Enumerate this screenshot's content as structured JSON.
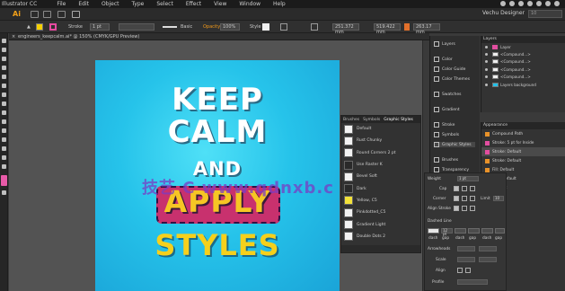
{
  "menubar": {
    "app": "Illustrator CC",
    "items": [
      "File",
      "Edit",
      "Object",
      "Type",
      "Select",
      "Effect",
      "View",
      "Window",
      "Help"
    ]
  },
  "toolbar": {
    "logo": "Ai",
    "workspace": "Vechu Designer",
    "search_value": "10"
  },
  "controlbar": {
    "stroke_label": "Stroke",
    "stroke_value": "1 pt",
    "brush_label": "Basic",
    "opacity_label": "Opacity",
    "opacity_value": "100%",
    "style_label": "Style",
    "x_value": "251.372 mm",
    "y_value": "519.422 mm",
    "w_value": "263.17 mm"
  },
  "doc_tab": "engineers_keepcalm.ai* @ 150% (CMYK/GPU Preview)",
  "artboard": {
    "line1": "KEEP",
    "line2": "CALM",
    "line3": "AND",
    "line4": "APPLY",
    "line5": "STYLES"
  },
  "watermark": "技艺 C  www.qdnxb.c",
  "graphic_styles": {
    "tabs": [
      "Brushes",
      "Symbols",
      "Graphic Styles"
    ],
    "items": [
      "Default",
      "Rust Chunky",
      "Round Corners 2 pt",
      "Use Raster K",
      "Bevel Soft",
      "Dark",
      "Yellow, C5",
      "Pinkdotted_C5",
      "Gradient Light",
      "Double Dots 2"
    ]
  },
  "icon_panels": {
    "items": [
      "Layers",
      "Color",
      "Color Guide",
      "Color Themes",
      "Swatches",
      "Gradient",
      "Stroke",
      "Symbols",
      "Graphic Styles",
      "Brushes",
      "Transparency"
    ]
  },
  "layers": {
    "header": "Layers",
    "rows": [
      "Layer",
      "<Compound...>",
      "<Compound...>",
      "<Compound...>",
      "<Compound...>",
      "Layers background"
    ]
  },
  "appearance": {
    "header": "Appearance",
    "rows": [
      "Compound Path",
      "Stroke: 5 pt  for Inside",
      "Stroke: Default",
      "Stroke: Default",
      "Fill: Default",
      "Opacity: Default",
      "Fill: Default"
    ]
  },
  "stroke_panel": {
    "weight_label": "Weight",
    "weight_value": "1 pt",
    "cap_label": "Cap",
    "corner_label": "Corner",
    "limit_label": "Limit",
    "limit_value": "10",
    "align_label": "Align Stroke",
    "dashed_label": "Dashed Line",
    "dash_labels": [
      "dash",
      "gap",
      "dash",
      "gap",
      "dash",
      "gap"
    ],
    "dash_value": "12 pt",
    "arrowheads_label": "Arrowheads",
    "scale_label": "Scale",
    "align_label2": "Align",
    "profile_label": "Profile"
  },
  "colors": {
    "accent_orange": "#f29a1a",
    "fill_yellow": "#f5d000",
    "stroke_pink": "#e64aa0",
    "artboard_cyan": "#26c3ea",
    "apply_box": "#c8316e",
    "styles_yellow": "#f6d01c"
  }
}
